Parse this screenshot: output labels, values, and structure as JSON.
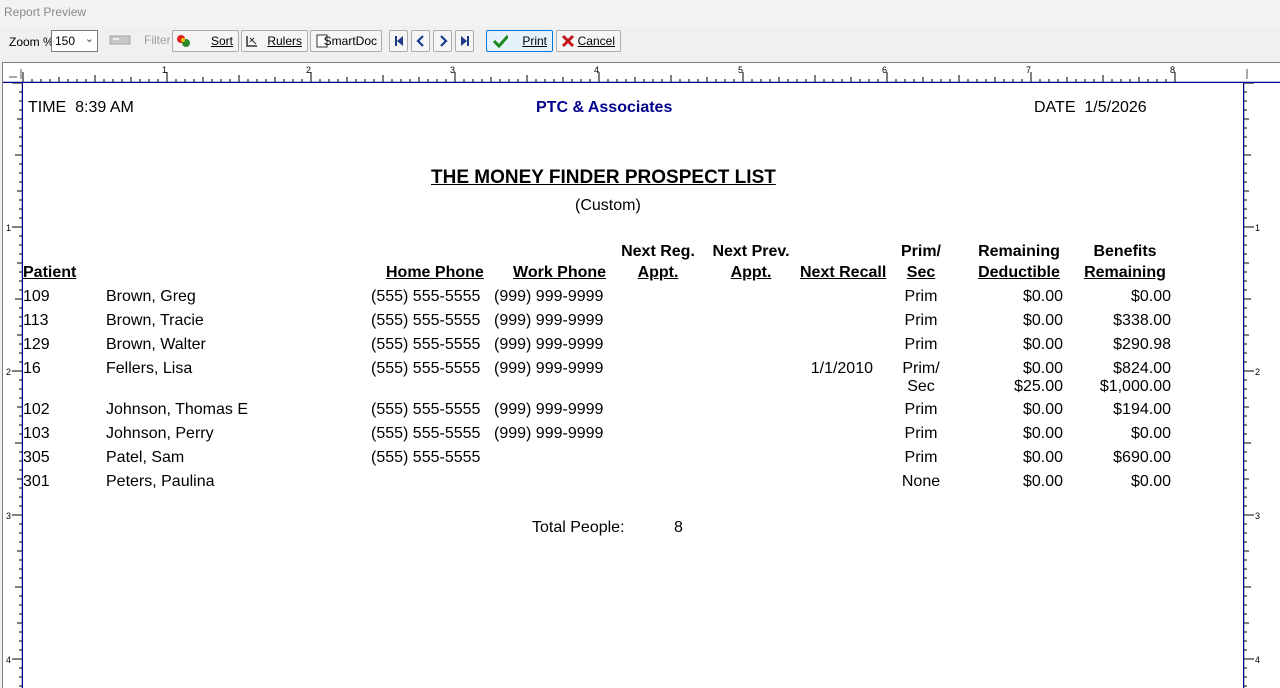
{
  "window": {
    "title": "Report Preview"
  },
  "toolbar": {
    "zoom_label": "Zoom %:",
    "zoom_value": "150",
    "filter_label": "Filter",
    "sort_label": "Sort",
    "rulers_label": "Rulers",
    "smartdoc_label": "SmartDoc",
    "print_label": "Print",
    "cancel_label": "Cancel"
  },
  "ruler": {
    "h_numbers": [
      "1",
      "2",
      "3",
      "4",
      "5",
      "6",
      "7",
      "8"
    ],
    "v_numbers": [
      "1",
      "2",
      "3",
      "4"
    ]
  },
  "report": {
    "time_label": "TIME",
    "time_value": "8:39 AM",
    "company": "PTC & Associates",
    "date_label": "DATE",
    "date_value": "1/5/2026",
    "title": "THE MONEY FINDER PROSPECT LIST",
    "subtitle": "(Custom)",
    "columns": {
      "patient": "Patient",
      "home_phone": "Home Phone",
      "work_phone": "Work Phone",
      "next_reg_1": "Next Reg.",
      "next_reg_2": "Appt.",
      "next_prev_1": "Next Prev.",
      "next_prev_2": "Appt.",
      "next_recall": "Next Recall",
      "prim_1": "Prim/",
      "prim_2": "Sec",
      "rem_1": "Remaining",
      "rem_2": "Deductible",
      "ben_1": "Benefits",
      "ben_2": "Remaining"
    },
    "rows": [
      {
        "id": "109",
        "name": "Brown, Greg",
        "home": "(555) 555-5555",
        "work": "(999) 999-9999",
        "recall": "",
        "ps": "Prim",
        "ded": "$0.00",
        "ben": "$0.00"
      },
      {
        "id": "113",
        "name": "Brown, Tracie",
        "home": "(555) 555-5555",
        "work": "(999) 999-9999",
        "recall": "",
        "ps": "Prim",
        "ded": "$0.00",
        "ben": "$338.00"
      },
      {
        "id": "129",
        "name": "Brown, Walter",
        "home": "(555) 555-5555",
        "work": "(999) 999-9999",
        "recall": "",
        "ps": "Prim",
        "ded": "$0.00",
        "ben": "$290.98"
      },
      {
        "id": "16",
        "name": "Fellers, Lisa",
        "home": "(555) 555-5555",
        "work": "(999) 999-9999",
        "recall": "1/1/2010",
        "ps": "Prim/",
        "ded": "$0.00",
        "ben": "$824.00",
        "ps2": "Sec",
        "ded2": "$25.00",
        "ben2": "$1,000.00"
      },
      {
        "id": "102",
        "name": "Johnson, Thomas E",
        "home": "(555) 555-5555",
        "work": "(999) 999-9999",
        "recall": "",
        "ps": "Prim",
        "ded": "$0.00",
        "ben": "$194.00"
      },
      {
        "id": "103",
        "name": "Johnson, Perry",
        "home": "(555) 555-5555",
        "work": "(999) 999-9999",
        "recall": "",
        "ps": "Prim",
        "ded": "$0.00",
        "ben": "$0.00"
      },
      {
        "id": "305",
        "name": "Patel, Sam",
        "home": "(555) 555-5555",
        "work": "",
        "recall": "",
        "ps": "Prim",
        "ded": "$0.00",
        "ben": "$690.00"
      },
      {
        "id": "301",
        "name": "Peters, Paulina",
        "home": "",
        "work": "",
        "recall": "",
        "ps": "None",
        "ded": "$0.00",
        "ben": "$0.00"
      }
    ],
    "total_label": "Total People:",
    "total_value": "8"
  }
}
